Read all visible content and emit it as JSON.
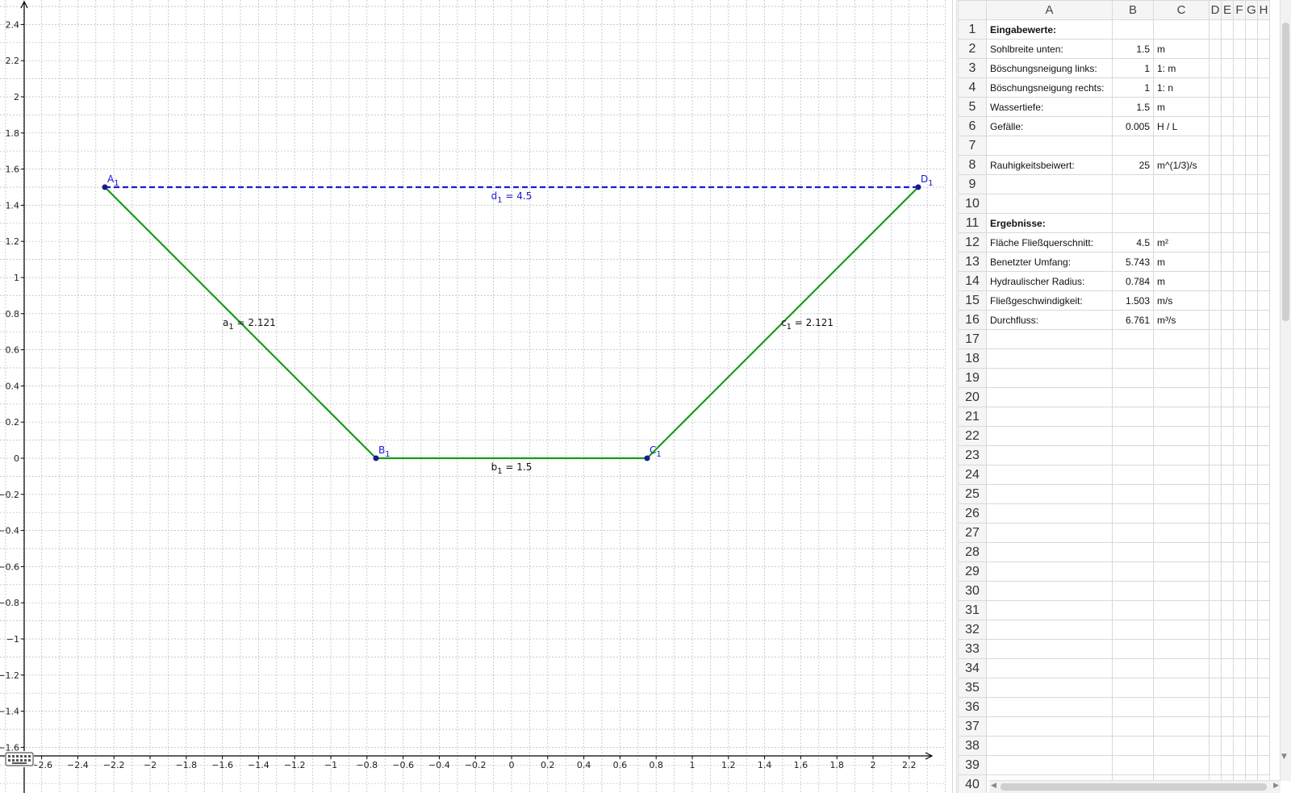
{
  "graphics": {
    "colors": {
      "grid": "#b9b9b9",
      "axis": "#000000",
      "trapezoid": "#1a9a1a",
      "surface": "#1a1ad0",
      "point": "#1a1a8c",
      "point_label": "#1a1ad0"
    },
    "x_ticks": [
      -2.6,
      -2.4,
      -2.2,
      -2,
      -1.8,
      -1.6,
      -1.4,
      -1.2,
      -1,
      -0.8,
      -0.6,
      -0.4,
      -0.2,
      0,
      0.2,
      0.4,
      0.6,
      0.8,
      1,
      1.2,
      1.4,
      1.6,
      1.8,
      2,
      2.2
    ],
    "y_ticks": [
      -1.6,
      -1.4,
      -1.2,
      -1,
      -0.8,
      -0.6,
      -0.4,
      -0.2,
      0,
      0.2,
      0.4,
      0.6,
      0.8,
      1,
      1.2,
      1.4,
      1.6,
      1.8,
      2,
      2.2,
      2.4
    ],
    "points": [
      {
        "name": "A",
        "sub": "1",
        "x": -2.25,
        "y": 1.5
      },
      {
        "name": "B",
        "sub": "1",
        "x": -0.75,
        "y": 0
      },
      {
        "name": "C",
        "sub": "1",
        "x": 0.75,
        "y": 0
      },
      {
        "name": "D",
        "sub": "1",
        "x": 2.25,
        "y": 1.5
      }
    ],
    "segments": [
      {
        "from": "A",
        "to": "B",
        "style": "solid",
        "label": "a",
        "sub": "1",
        "value": "= 2.121"
      },
      {
        "from": "B",
        "to": "C",
        "style": "solid",
        "label": "b",
        "sub": "1",
        "value": "= 1.5"
      },
      {
        "from": "C",
        "to": "D",
        "style": "solid",
        "label": "c",
        "sub": "1",
        "value": "= 2.121"
      },
      {
        "from": "A",
        "to": "D",
        "style": "dashed",
        "label": "d",
        "sub": "1",
        "value": "= 4.5"
      }
    ]
  },
  "spreadsheet": {
    "columns": [
      "A",
      "B",
      "C",
      "D",
      "E",
      "F",
      "G",
      "H"
    ],
    "rows": [
      {
        "n": "1",
        "a": "Eingabewerte:",
        "b": "",
        "c": "",
        "bold": true
      },
      {
        "n": "2",
        "a": "Sohlbreite unten:",
        "b": "1.5",
        "c": "m"
      },
      {
        "n": "3",
        "a": "Böschungsneigung links:",
        "b": "1",
        "c": "1: m"
      },
      {
        "n": "4",
        "a": "Böschungsneigung rechts:",
        "b": "1",
        "c": "1: n"
      },
      {
        "n": "5",
        "a": "Wassertiefe:",
        "b": "1.5",
        "c": "m"
      },
      {
        "n": "6",
        "a": "Gefälle:",
        "b": "0.005",
        "c": "H / L"
      },
      {
        "n": "7",
        "a": "",
        "b": "",
        "c": ""
      },
      {
        "n": "8",
        "a": "Rauhigkeitsbeiwert:",
        "b": "25",
        "c": "m^(1/3)/s"
      },
      {
        "n": "9",
        "a": "",
        "b": "",
        "c": ""
      },
      {
        "n": "10",
        "a": "",
        "b": "",
        "c": ""
      },
      {
        "n": "11",
        "a": "Ergebnisse:",
        "b": "",
        "c": "",
        "bold": true
      },
      {
        "n": "12",
        "a": "Fläche Fließquerschnitt:",
        "b": "4.5",
        "c": "m²"
      },
      {
        "n": "13",
        "a": "Benetzter Umfang:",
        "b": "5.743",
        "c": "m"
      },
      {
        "n": "14",
        "a": "Hydraulischer Radius:",
        "b": "0.784",
        "c": "m"
      },
      {
        "n": "15",
        "a": "Fließgeschwindigkeit:",
        "b": "1.503",
        "c": "m/s"
      },
      {
        "n": "16",
        "a": "Durchfluss:",
        "b": "6.761",
        "c": "m³/s"
      },
      {
        "n": "17",
        "a": "",
        "b": "",
        "c": ""
      },
      {
        "n": "18",
        "a": "",
        "b": "",
        "c": ""
      },
      {
        "n": "19",
        "a": "",
        "b": "",
        "c": ""
      },
      {
        "n": "20",
        "a": "",
        "b": "",
        "c": ""
      },
      {
        "n": "21",
        "a": "",
        "b": "",
        "c": ""
      },
      {
        "n": "22",
        "a": "",
        "b": "",
        "c": ""
      },
      {
        "n": "23",
        "a": "",
        "b": "",
        "c": ""
      },
      {
        "n": "24",
        "a": "",
        "b": "",
        "c": ""
      },
      {
        "n": "25",
        "a": "",
        "b": "",
        "c": ""
      },
      {
        "n": "26",
        "a": "",
        "b": "",
        "c": ""
      },
      {
        "n": "27",
        "a": "",
        "b": "",
        "c": ""
      },
      {
        "n": "28",
        "a": "",
        "b": "",
        "c": ""
      },
      {
        "n": "29",
        "a": "",
        "b": "",
        "c": ""
      },
      {
        "n": "30",
        "a": "",
        "b": "",
        "c": ""
      },
      {
        "n": "31",
        "a": "",
        "b": "",
        "c": ""
      },
      {
        "n": "32",
        "a": "",
        "b": "",
        "c": ""
      },
      {
        "n": "33",
        "a": "",
        "b": "",
        "c": ""
      },
      {
        "n": "34",
        "a": "",
        "b": "",
        "c": ""
      },
      {
        "n": "35",
        "a": "",
        "b": "",
        "c": ""
      },
      {
        "n": "36",
        "a": "",
        "b": "",
        "c": ""
      },
      {
        "n": "37",
        "a": "",
        "b": "",
        "c": ""
      },
      {
        "n": "38",
        "a": "",
        "b": "",
        "c": ""
      },
      {
        "n": "39",
        "a": "",
        "b": "",
        "c": ""
      },
      {
        "n": "40",
        "a": "",
        "b": "",
        "c": ""
      }
    ]
  },
  "icons": {
    "keyboard": "keyboard-icon"
  }
}
